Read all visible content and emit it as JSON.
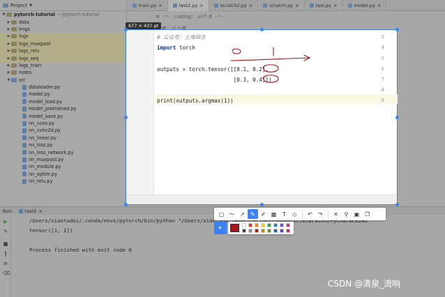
{
  "project": {
    "header_label": "Project",
    "root_name": "pytorch-tutorial",
    "root_path": "~/pytorch-tutorial",
    "folders": [
      "data",
      "imgs",
      "logs",
      "logs_maxpool",
      "logs_relu",
      "logs_seq",
      "logs_train",
      "notes",
      "src"
    ],
    "files": [
      "dataloader.py",
      "model.py",
      "model_load.py",
      "model_pretrained.py",
      "model_save.py",
      "nn_conv.py",
      "nn_conv2d.py",
      "nn_linear.py",
      "nn_loss.py",
      "nn_loss_network.py",
      "nn_maxpool.py",
      "nn_module.py",
      "nn_optim.py",
      "nn_relu.py"
    ]
  },
  "tabs": [
    "train.py",
    "test2.py",
    "scratch2.py",
    "scratch.py",
    "test.py",
    "model.py"
  ],
  "background": {
    "coding_line": "# -*- coding: utf-8 -*-",
    "author_line": "作者：小土堆"
  },
  "capture": {
    "size_label": "677 × 437  pt",
    "line_numbers": [
      "3",
      "4",
      "5",
      "6",
      "7",
      "8",
      "9"
    ],
    "code": {
      "l3": "# 公众号：土堆碎念",
      "l4_kw": "import",
      "l4_rest": " torch",
      "l6": "outputs = torch.tensor([[0.1, 0.2],",
      "l7": "                        [0.3, 0.4]])",
      "l9": "print(outputs.argmax(1))"
    },
    "annotation_color": "#a8141b"
  },
  "run": {
    "label": "Run:",
    "tab": "test2",
    "cmd": "/Users/xiaotudui/.conda/envs/pytorch/bin/python \"/Users/xiaotudui/Applications/Support/JetBrains/PyCharmCE202",
    "result": "tensor([1, 1])",
    "finished": "Process finished with exit code 0"
  },
  "toolbar": {
    "tools": [
      "rect-icon",
      "line-icon",
      "arrow-icon",
      "pen-icon",
      "marker-icon",
      "mosaic-icon",
      "text-icon",
      "eraser-icon",
      "undo-icon",
      "redo-icon",
      "close-icon",
      "pin-icon",
      "save-icon",
      "copy-icon"
    ],
    "active_tool": "pen-icon"
  },
  "palette": [
    "#ffffff",
    "#e03131",
    "#f08c00",
    "#f5d90a",
    "#2f9e44",
    "#1c7ed6",
    "#7048e8",
    "#d6336c",
    "#444444",
    "#868e96",
    "#a8141b",
    "#b8860b",
    "#6b8e23",
    "#1864ab",
    "#5f3dc4",
    "#c2255c"
  ],
  "watermark": "CSDN @清泉_流响"
}
